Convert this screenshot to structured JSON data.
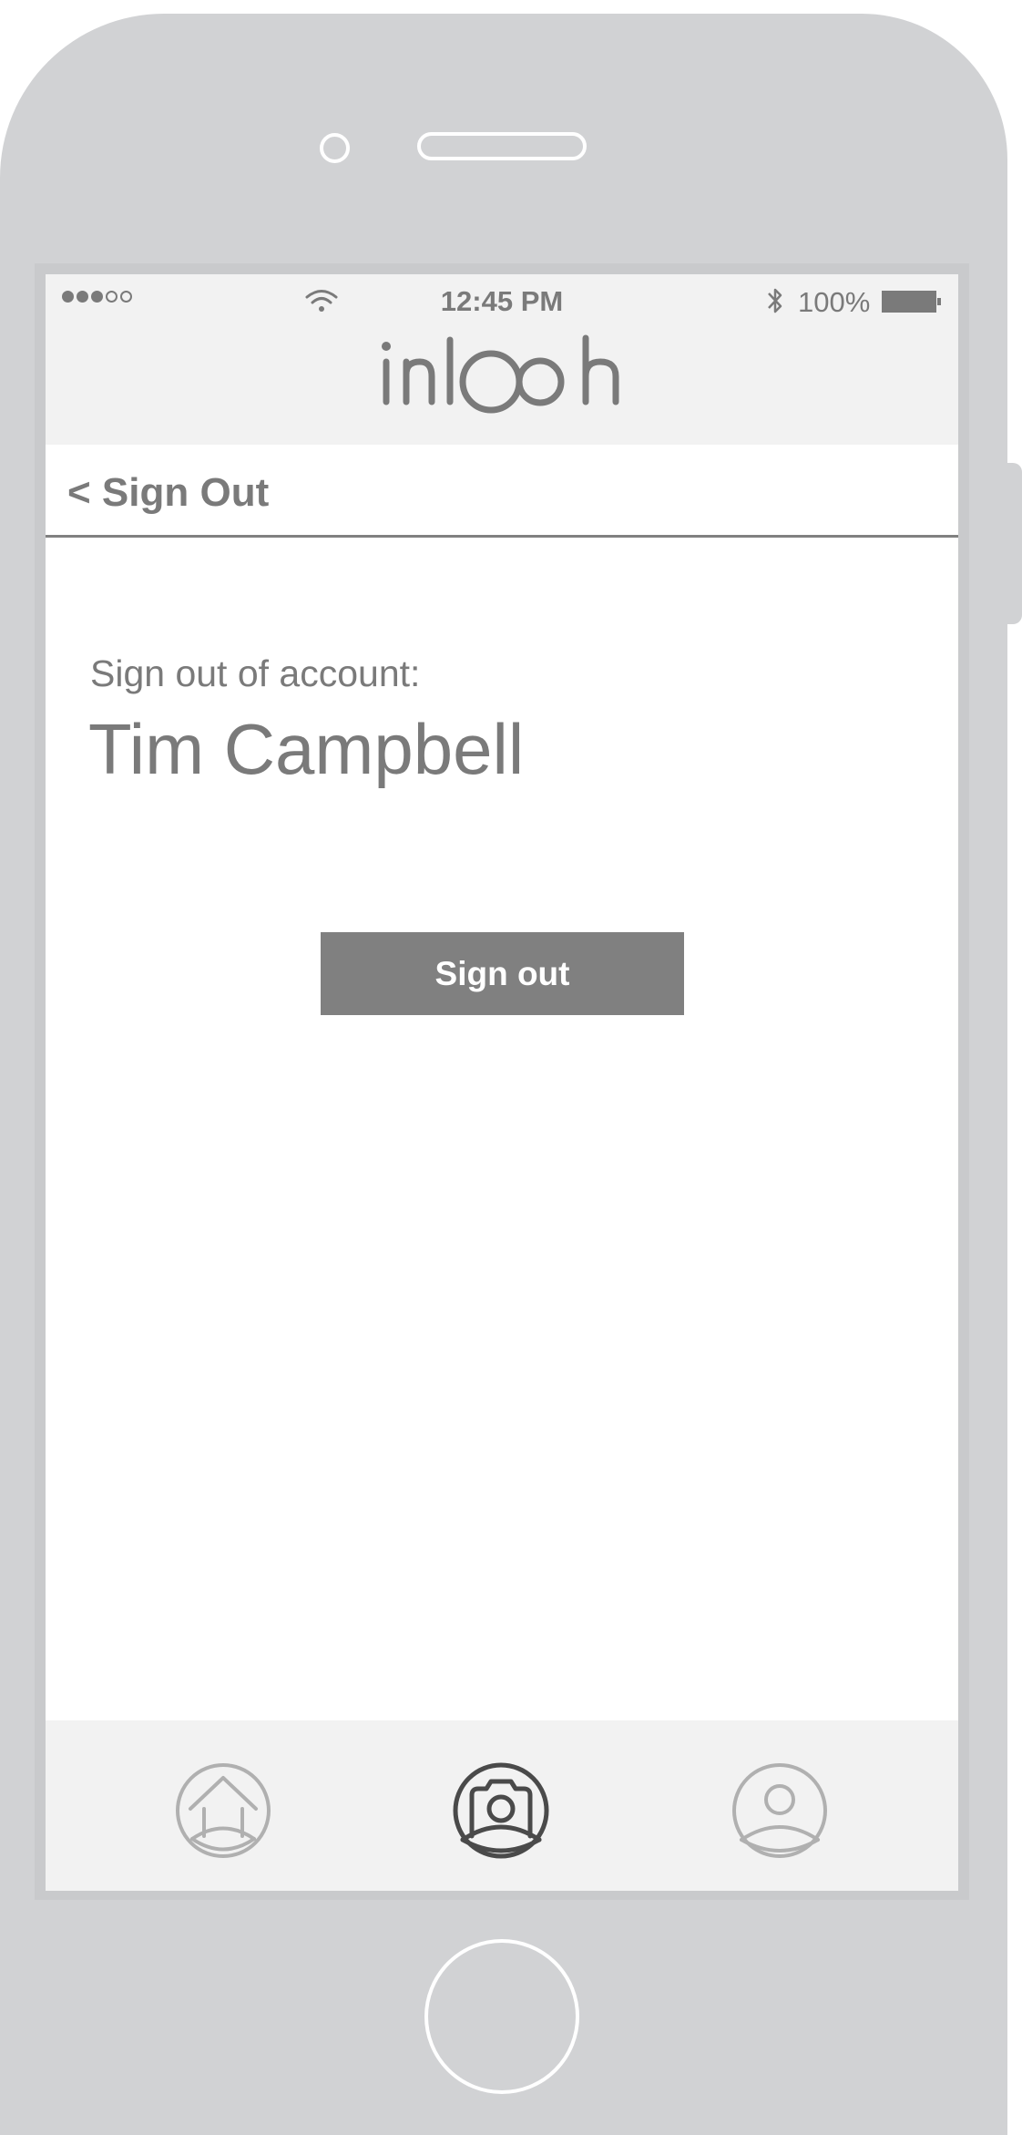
{
  "status_bar": {
    "time": "12:45 PM",
    "battery": "100%",
    "signal_dots_filled": 3,
    "signal_dots_total": 5
  },
  "header": {
    "logo_text": "inlooh"
  },
  "nav": {
    "back_label": "< Sign Out"
  },
  "account": {
    "label": "Sign out of account:",
    "name": "Tim Campbell"
  },
  "actions": {
    "sign_out_button": "Sign out"
  },
  "tabbar": {
    "items": [
      {
        "icon": "home-icon",
        "active": false
      },
      {
        "icon": "camera-icon",
        "active": true
      },
      {
        "icon": "profile-icon",
        "active": false
      }
    ]
  },
  "colors": {
    "text_gray": "#7a7a7a",
    "button_gray": "#808080",
    "active_icon": "#4a4a4a",
    "inactive_icon": "#b0b0b0",
    "bar_background": "#f2f2f2",
    "device_body": "#d1d2d4"
  }
}
